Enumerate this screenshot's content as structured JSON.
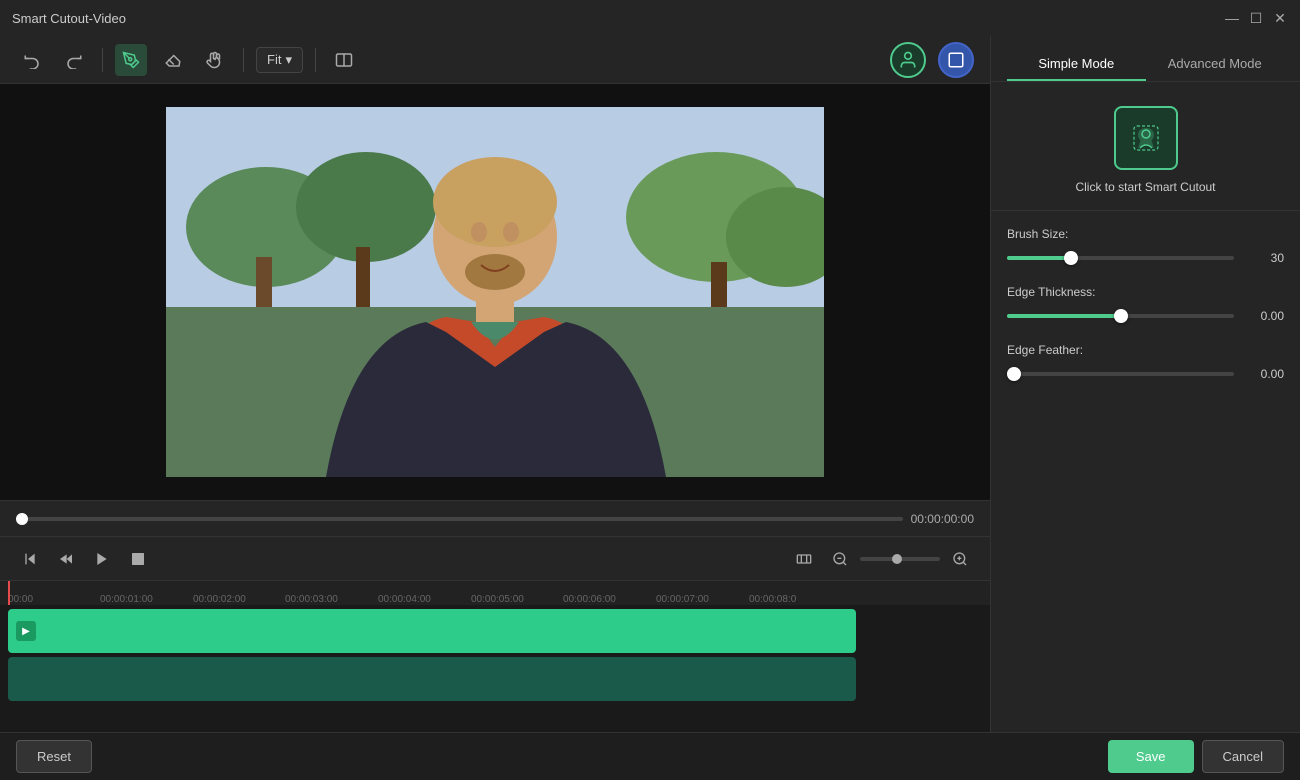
{
  "app": {
    "title": "Smart Cutout-Video"
  },
  "titlebar": {
    "title": "Smart Cutout-Video",
    "minimize_label": "—",
    "maximize_label": "☐",
    "close_label": "✕"
  },
  "toolbar": {
    "fit_label": "Fit",
    "chevron": "▾"
  },
  "right_panel": {
    "simple_mode_label": "Simple Mode",
    "advanced_mode_label": "Advanced Mode",
    "cutout_label": "Click to start Smart Cutout",
    "brush_size_label": "Brush Size:",
    "brush_size_value": "30",
    "brush_size_pct": 28,
    "edge_thickness_label": "Edge Thickness:",
    "edge_thickness_value": "0.00",
    "edge_thickness_pct": 50,
    "edge_feather_label": "Edge Feather:",
    "edge_feather_value": "0.00",
    "edge_feather_pct": 0
  },
  "timeline": {
    "time_display": "00:00:00:00",
    "marks": [
      {
        "time": "00:00",
        "pos": 8
      },
      {
        "time": "00:00:01:00",
        "pos": 100
      },
      {
        "time": "00:00:02:00",
        "pos": 193
      },
      {
        "time": "00:00:03:00",
        "pos": 285
      },
      {
        "time": "00:00:04:00",
        "pos": 378
      },
      {
        "time": "00:00:05:00",
        "pos": 471
      },
      {
        "time": "00:00:06:00",
        "pos": 563
      },
      {
        "time": "00:00:07:00",
        "pos": 656
      },
      {
        "time": "00:00:08:0",
        "pos": 749
      }
    ]
  },
  "bottom_bar": {
    "reset_label": "Reset",
    "save_label": "Save",
    "cancel_label": "Cancel"
  }
}
